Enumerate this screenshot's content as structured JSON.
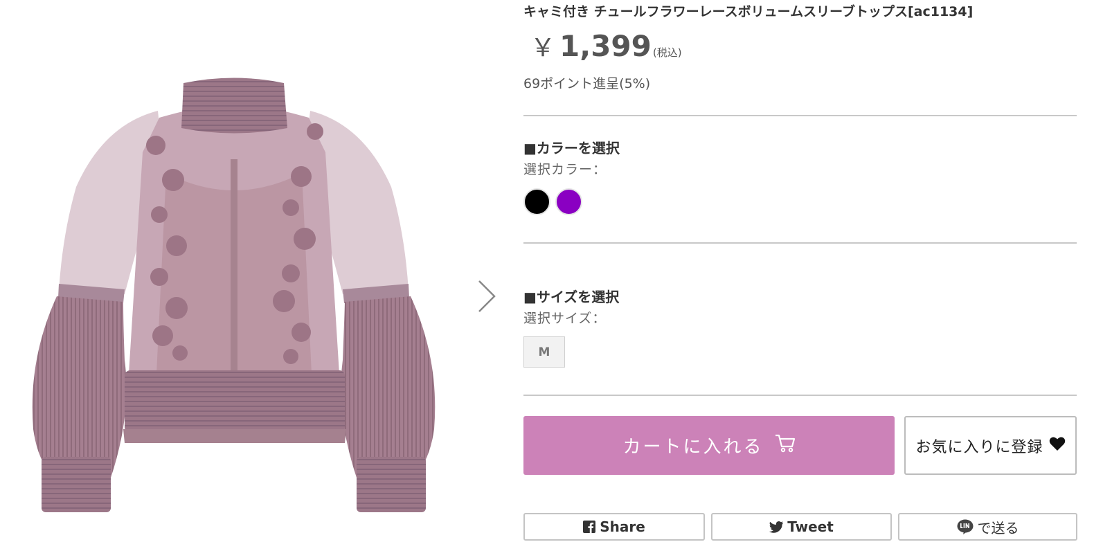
{
  "product": {
    "title": "キャミ付き チュールフラワーレースボリュームスリーブトップス[ac1134]",
    "price_symbol": "￥",
    "price": "1,399",
    "tax_note": "(税込)",
    "points": "69ポイント進呈(5%)"
  },
  "color_section": {
    "heading": "■カラーを選択",
    "selected_label": "選択カラー：",
    "swatches": [
      {
        "name": "black",
        "color": "#000000"
      },
      {
        "name": "purple",
        "color": "#8a00c2"
      }
    ]
  },
  "size_section": {
    "heading": "■サイズを選択",
    "selected_label": "選択サイズ：",
    "sizes": [
      "M"
    ]
  },
  "actions": {
    "cart_label": "カートに入れる",
    "cart_icon": "cart-icon",
    "favorite_label": "お気に入りに登録",
    "favorite_icon": "heart-icon",
    "accent_color": "#cc82b8"
  },
  "share": {
    "facebook_label": "Share",
    "twitter_label": "Tweet",
    "line_label": "で送る"
  },
  "gallery": {
    "next_icon": "chevron-right-icon"
  }
}
